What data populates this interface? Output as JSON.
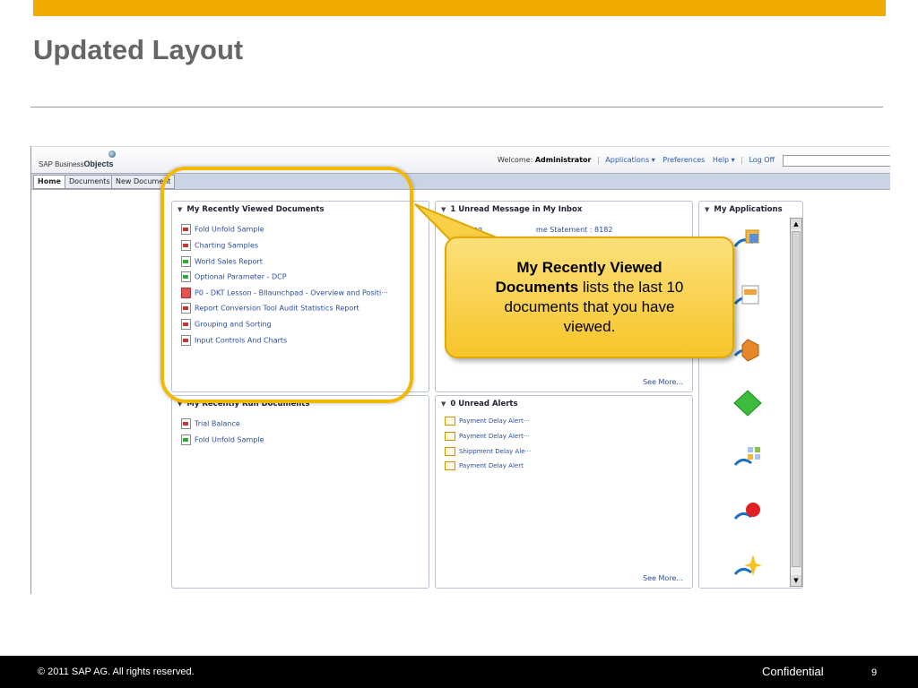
{
  "slide": {
    "title": "Updated Layout",
    "accent_color": "#F0AB00"
  },
  "app": {
    "logo_prefix": "SAP Business",
    "logo_bold": "Objects",
    "welcome_label": "Welcome:",
    "user": "Administrator",
    "links": {
      "applications": "Applications ▾",
      "preferences": "Preferences",
      "help": "Help ▾",
      "logoff": "Log Off"
    },
    "search_value": ""
  },
  "tabs": [
    "Home",
    "Documents",
    "New Document"
  ],
  "recently_viewed": {
    "title": "My Recently Viewed Documents",
    "items": [
      "Fold Unfold Sample",
      "Charting Samples",
      "World Sales Report",
      "Optional Parameter - DCP",
      "P0 - DKT Lesson - BIlaunchpad - Overview and Positi···",
      "Report Conversion Tool Audit Statistics Report",
      "Grouping and Sorting",
      "Input Controls And Charts"
    ]
  },
  "inbox": {
    "title": "1 Unread Message in My Inbox",
    "item_start": "Rolling",
    "item_end": "me Statement : 8182",
    "see_more": "See More..."
  },
  "recently_run": {
    "title": "My Recently Run Documents",
    "items": [
      "Trial Balance",
      "Fold Unfold Sample"
    ]
  },
  "alerts": {
    "title": "0 Unread Alerts",
    "items": [
      "Payment Delay Alert···",
      "Payment Delay Alert···",
      "Shippment Delay Ale···",
      "Payment Delay Alert"
    ],
    "see_more": "See More..."
  },
  "applications": {
    "title": "My Applications",
    "icons": [
      "folder-app-icon",
      "document-app-icon",
      "cube-app-icon",
      "green-diamond-icon",
      "grid-app-icon",
      "pin-app-icon",
      "star-app-icon"
    ]
  },
  "callout": {
    "bold": "My Recently Viewed Documents",
    "text": " lists the last 10 documents that you have viewed."
  },
  "footer": {
    "copyright": "©  2011 SAP AG. All rights reserved.",
    "confidential": "Confidential",
    "page": "9"
  }
}
